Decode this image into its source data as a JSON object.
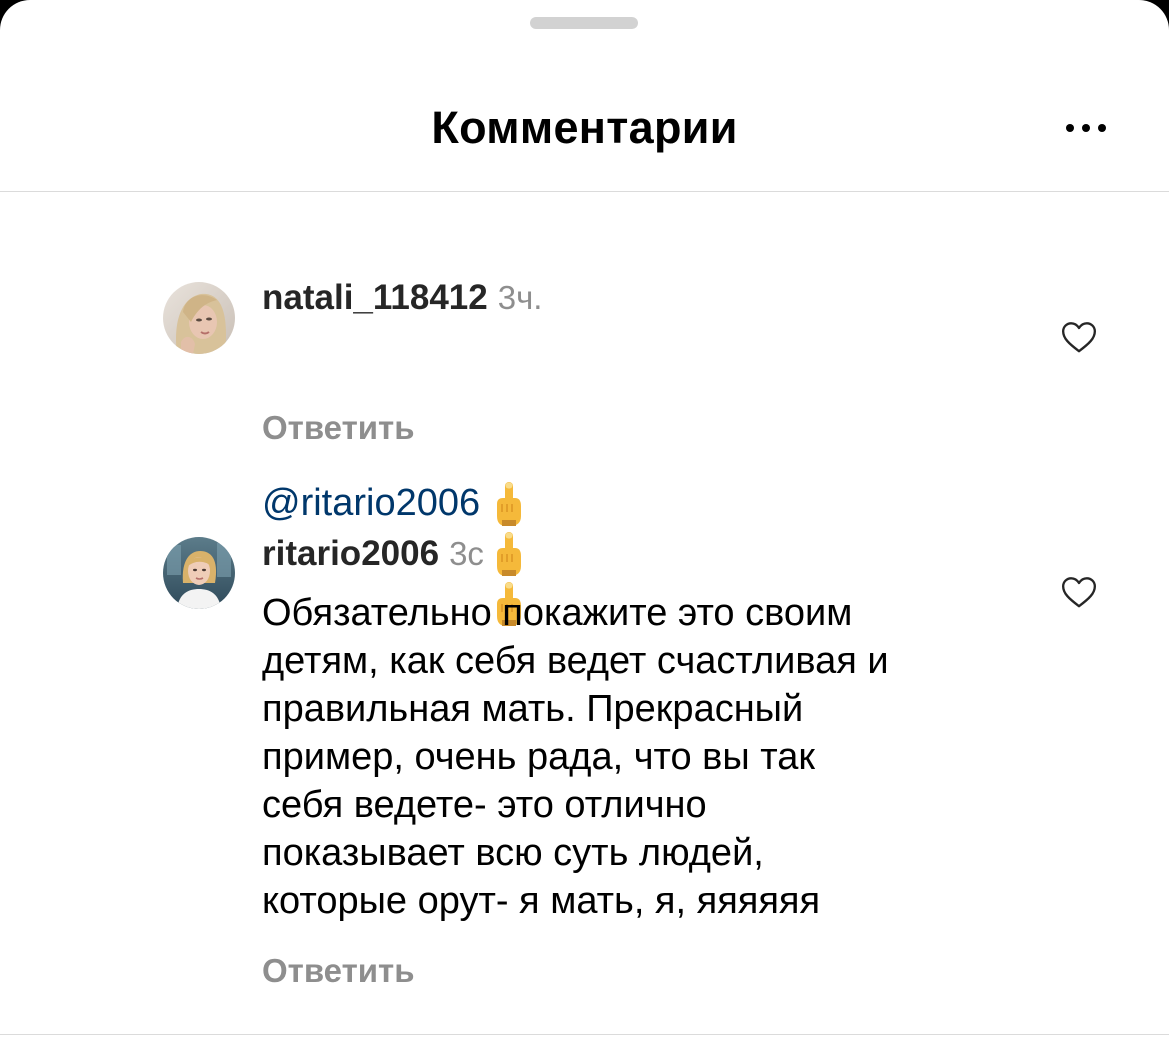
{
  "header": {
    "title": "Комментарии"
  },
  "comments": [
    {
      "username": "natali_118412",
      "time": "3ч.",
      "mention": "@ritario2006",
      "emoji": "🖕🖕🖕",
      "reply_label": "Ответить"
    },
    {
      "username": "ritario2006",
      "time": "3с",
      "text": "Обязательно покажите это своим\nдетям, как себя ведет счастливая и\nправильная мать.  Прекрасный\nпример, очень рада, что вы так\nсебя ведете- это отлично\nпоказывает всю суть людей,\nкоторые орут- я мать, я, яяяяяя",
      "reply_label": "Ответить"
    }
  ],
  "icons": {
    "more": "more-horizontal-icon",
    "like": "heart-icon"
  },
  "colors": {
    "mention": "#00376b",
    "secondary_text": "#8e8e8e",
    "divider": "#dbdbdb"
  }
}
